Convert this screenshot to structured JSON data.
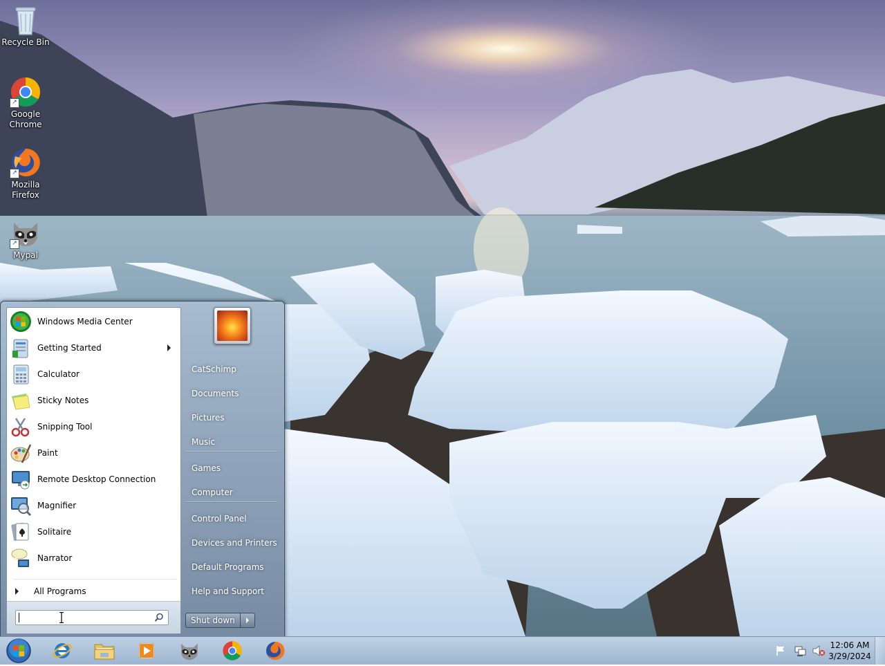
{
  "desktop": {
    "icons": [
      {
        "label_line1": "Recycle Bin",
        "label_line2": "",
        "icon": "recycle-bin-icon"
      },
      {
        "label_line1": "Google",
        "label_line2": "Chrome",
        "icon": "chrome-icon"
      },
      {
        "label_line1": "Mozilla",
        "label_line2": "Firefox",
        "icon": "firefox-icon"
      },
      {
        "label_line1": "Mypal",
        "label_line2": "",
        "icon": "raccoon-icon"
      }
    ]
  },
  "start_menu": {
    "programs": [
      {
        "label": "Windows Media Center",
        "icon": "windows-media-center-icon"
      },
      {
        "label": "Getting Started",
        "icon": "getting-started-icon",
        "submenu": true
      },
      {
        "label": "Calculator",
        "icon": "calculator-icon"
      },
      {
        "label": "Sticky Notes",
        "icon": "sticky-notes-icon"
      },
      {
        "label": "Snipping Tool",
        "icon": "snipping-tool-icon"
      },
      {
        "label": "Paint",
        "icon": "paint-icon"
      },
      {
        "label": "Remote Desktop Connection",
        "icon": "remote-desktop-icon"
      },
      {
        "label": "Magnifier",
        "icon": "magnifier-icon"
      },
      {
        "label": "Solitaire",
        "icon": "solitaire-icon"
      },
      {
        "label": "Narrator",
        "icon": "narrator-icon"
      }
    ],
    "all_programs_label": "All Programs",
    "search": {
      "placeholder": "",
      "value": ""
    },
    "right_links": [
      {
        "label": "CatSchimp"
      },
      {
        "label": "Documents"
      },
      {
        "label": "Pictures"
      },
      {
        "label": "Music"
      },
      {
        "label": "Games"
      },
      {
        "label": "Computer"
      },
      {
        "label": "Control Panel"
      },
      {
        "label": "Devices and Printers"
      },
      {
        "label": "Default Programs"
      },
      {
        "label": "Help and Support"
      }
    ],
    "shutdown_label": "Shut down"
  },
  "taskbar": {
    "pinned": [
      {
        "icon": "internet-explorer-icon"
      },
      {
        "icon": "file-explorer-icon"
      },
      {
        "icon": "media-player-icon"
      },
      {
        "icon": "raccoon-icon"
      },
      {
        "icon": "chrome-icon"
      },
      {
        "icon": "firefox-icon"
      }
    ],
    "tray_icons": [
      "action-center-flag-icon",
      "network-icon",
      "volume-muted-icon"
    ],
    "clock_time": "12:06 AM",
    "clock_date": "3/29/2024"
  }
}
